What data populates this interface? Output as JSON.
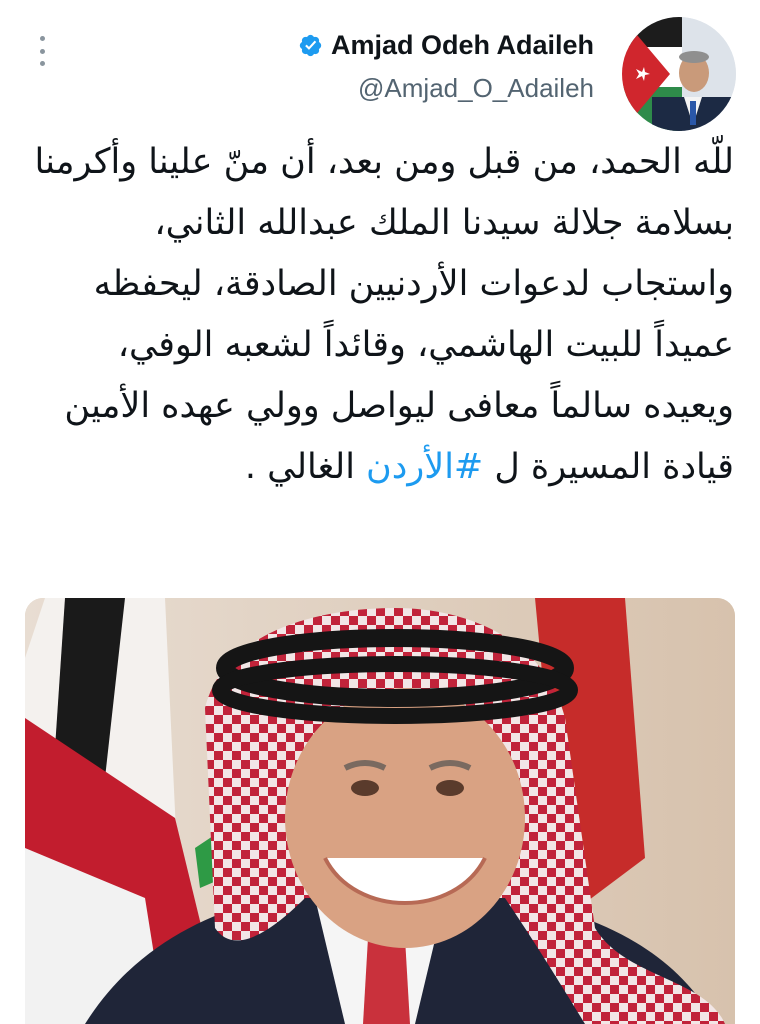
{
  "tweet": {
    "author": {
      "display_name": "Amjad Odeh Adaileh",
      "handle": "@Amjad_O_Adaileh",
      "verified_icon": "verified-badge-icon",
      "avatar": "profile-photo"
    },
    "more_icon": "more-options-icon",
    "text_before_hashtag": "للّه الحمد، من قبل ومن بعد، أن منّ علينا وأكرمنا بسلامة جلالة سيدنا الملك عبدالله الثاني، واستجاب لدعوات الأردنيين الصادقة، ليحفظه عميداً للبيت الهاشمي، وقائداً لشعبه الوفي، ويعيده سالماً معافى ليواصل وولي عهده الأمين قيادة المسيرة ل ",
    "hashtag": "#الأردن",
    "text_after_hashtag": " الغالي .",
    "media": {
      "kind": "photo",
      "subject": "portrait"
    }
  },
  "colors": {
    "text": "#0f1419",
    "secondary": "#536471",
    "link": "#1d9bf0",
    "verified": "#1d9bf0"
  }
}
